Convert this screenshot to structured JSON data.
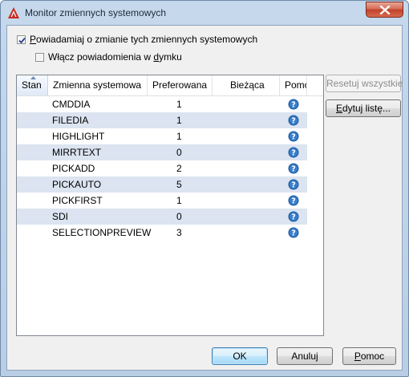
{
  "window": {
    "title": "Monitor zmiennych systemowych"
  },
  "options": {
    "notify_label_prefix": "P",
    "notify_label_rest": "owiadamiaj o zmianie tych zmiennych systemowych",
    "notify_checked": true,
    "balloon_label_prefix": "Włącz powiadomienia w ",
    "balloon_label_underlined": "d",
    "balloon_label_rest": "ymku",
    "balloon_checked": false
  },
  "table": {
    "columns": [
      "Stan",
      "Zmienna systemowa",
      "Preferowana",
      "Bieżąca",
      "Pomoc"
    ],
    "rows": [
      {
        "name": "CMDDIA",
        "preferred": "1"
      },
      {
        "name": "FILEDIA",
        "preferred": "1"
      },
      {
        "name": "HIGHLIGHT",
        "preferred": "1"
      },
      {
        "name": "MIRRTEXT",
        "preferred": "0"
      },
      {
        "name": "PICKADD",
        "preferred": "2"
      },
      {
        "name": "PICKAUTO",
        "preferred": "5"
      },
      {
        "name": "PICKFIRST",
        "preferred": "1"
      },
      {
        "name": "SDI",
        "preferred": "0"
      },
      {
        "name": "SELECTIONPREVIEW",
        "preferred": "3"
      }
    ],
    "help_icon": "question-circle-icon"
  },
  "side_buttons": {
    "reset_all": "Resetuj wszystkie",
    "edit_list_prefix": "E",
    "edit_list_rest": "dytuj listę..."
  },
  "footer": {
    "ok": "OK",
    "cancel": "Anuluj",
    "help_prefix": "P",
    "help_rest": "omoc"
  },
  "colors": {
    "row_alt": "#dbe4f0",
    "help_icon": "#1f5fa8",
    "close_button": "#c0412a"
  }
}
